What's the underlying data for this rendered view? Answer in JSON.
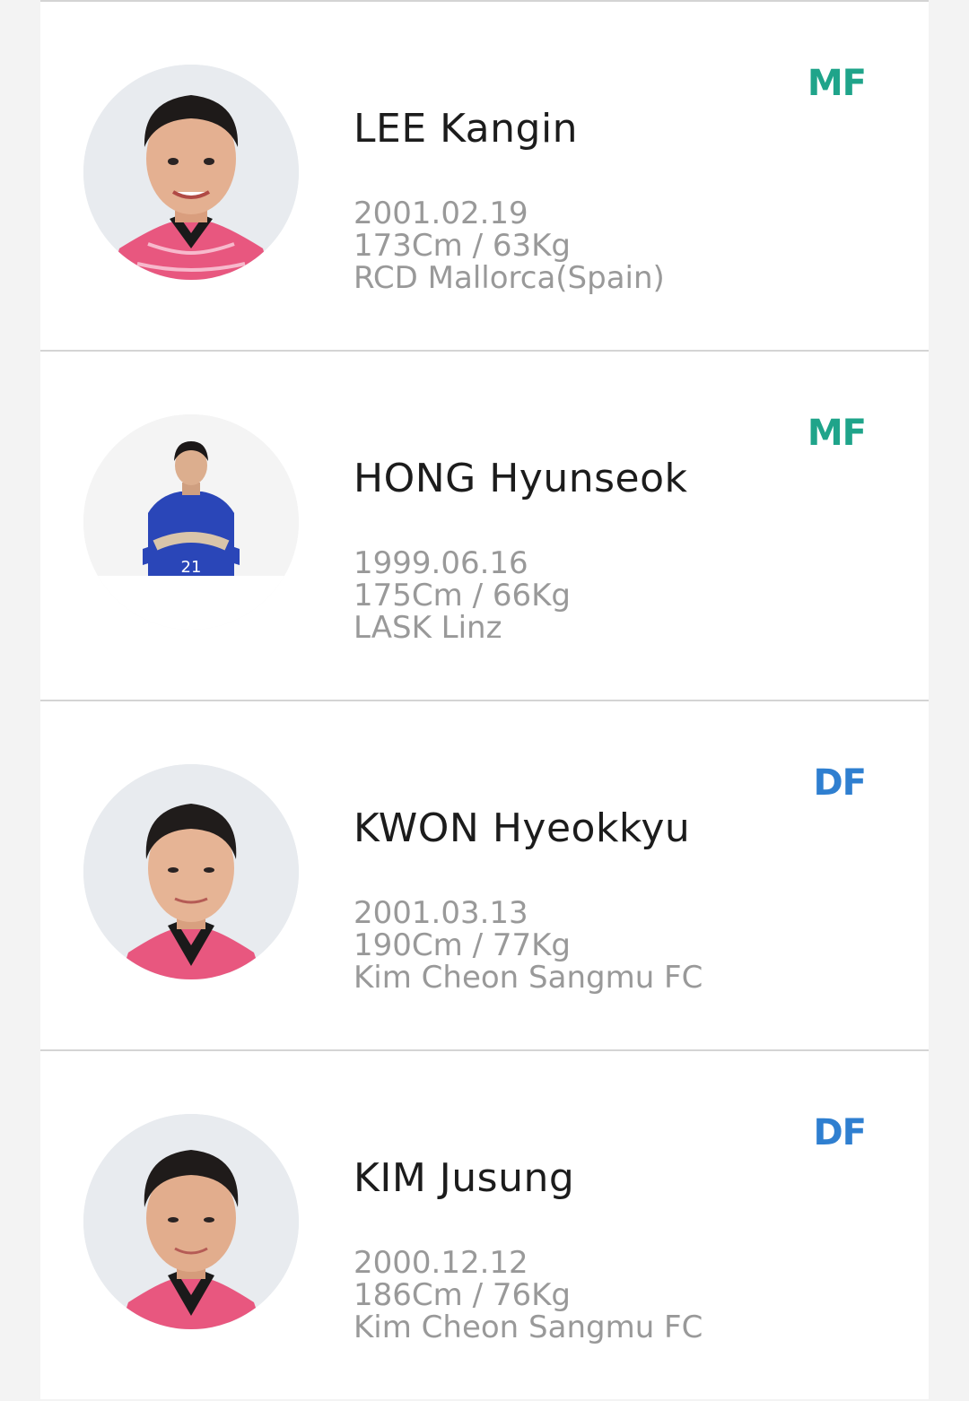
{
  "colors": {
    "MF": "#1fa48a",
    "DF": "#2f7fd0"
  },
  "players": [
    {
      "name": "LEE Kangin",
      "birth": "2001.02.19",
      "body": "173Cm / 63Kg",
      "club": "RCD Mallorca(Spain)",
      "position": "MF",
      "photo": "player-photo-red-kit"
    },
    {
      "name": "HONG Hyunseok",
      "birth": "1999.06.16",
      "body": "175Cm / 66Kg",
      "club": "LASK Linz",
      "position": "MF",
      "photo": "player-photo-blue-kit"
    },
    {
      "name": "KWON Hyeokkyu",
      "birth": "2001.03.13",
      "body": "190Cm / 77Kg",
      "club": "Kim Cheon Sangmu FC",
      "position": "DF",
      "photo": "player-photo-red-kit"
    },
    {
      "name": "KIM Jusung",
      "birth": "2000.12.12",
      "body": "186Cm / 76Kg",
      "club": "Kim Cheon Sangmu FC",
      "position": "DF",
      "photo": "player-photo-red-kit"
    }
  ]
}
